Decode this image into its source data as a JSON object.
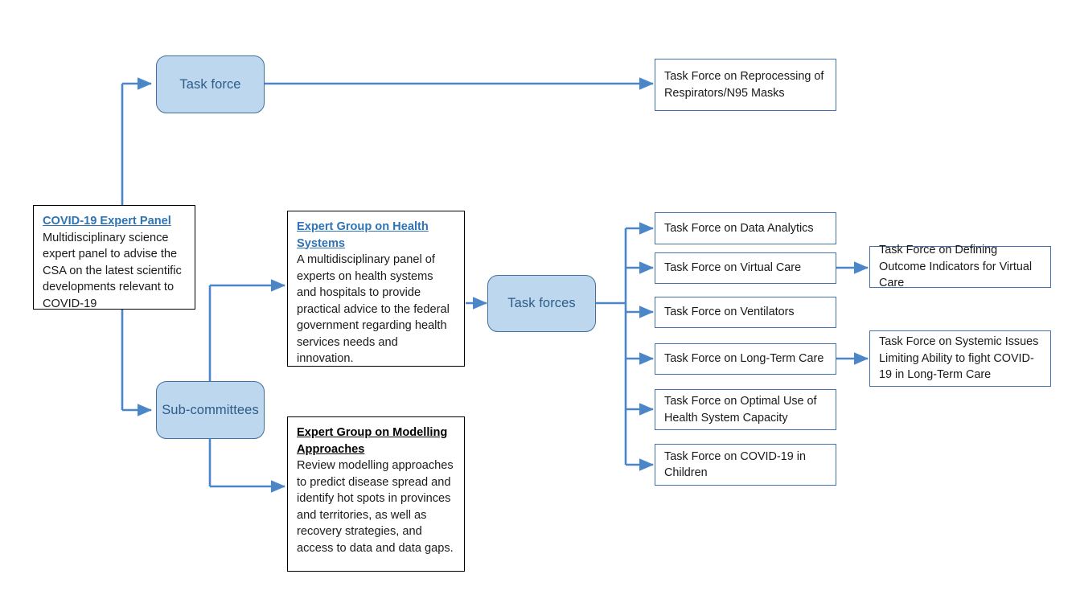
{
  "diagram": {
    "title": "COVID-19 Expert Panel organizational structure",
    "colors": {
      "node_fill": "#bdd7ee",
      "node_border": "#41719c",
      "node_text": "#2e5c8a",
      "connector": "#4a86c8",
      "heading_link": "#2e74b5",
      "box_border_black": "#000000",
      "box_border_blue": "#4472a8"
    }
  },
  "nodes": {
    "expert_panel": {
      "title": "COVID-19 Expert Panel",
      "body": "Multidisciplinary science expert panel to advise the CSA on the latest scientific developments relevant to COVID-19"
    },
    "task_force_group": {
      "label": "Task force"
    },
    "sub_committees": {
      "label": "Sub-committees"
    },
    "task_forces_group": {
      "label": "Task forces"
    },
    "health_systems": {
      "title": "Expert Group on Health Systems",
      "body": "A multidisciplinary panel of experts on health systems and hospitals to provide practical advice to the federal government regarding health services needs and innovation."
    },
    "modelling": {
      "title": "Expert Group on Modelling Approaches",
      "body": "Review modelling approaches to predict disease spread and identify hot spots in provinces and territories, as well as recovery strategies, and access to data and data gaps."
    },
    "reprocessing": {
      "label": "Task Force on Reprocessing of Respirators/N95 Masks"
    },
    "data_analytics": {
      "label": "Task Force on Data Analytics"
    },
    "virtual_care": {
      "label": "Task Force on Virtual Care"
    },
    "ventilators": {
      "label": "Task Force on Ventilators"
    },
    "long_term_care": {
      "label": "Task Force on Long-Term Care"
    },
    "optimal_use": {
      "label": "Task Force on Optimal Use of Health System Capacity"
    },
    "covid_children": {
      "label": "Task Force on COVID-19 in Children"
    },
    "outcome_indicators": {
      "label": "Task Force on Defining Outcome Indicators for Virtual Care"
    },
    "systemic_issues": {
      "label": "Task Force on Systemic Issues Limiting Ability to fight COVID-19 in Long-Term Care"
    }
  }
}
